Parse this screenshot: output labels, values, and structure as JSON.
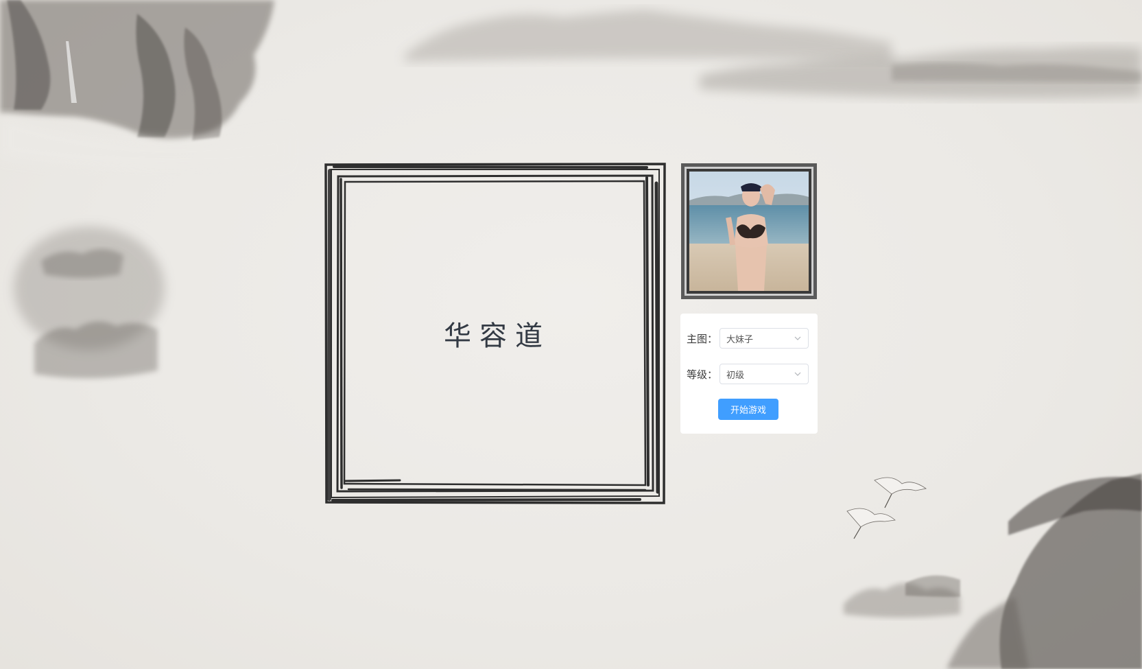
{
  "game": {
    "title": "华容道"
  },
  "controls": {
    "image_label": "主图：",
    "image_value": "大妹子",
    "level_label": "等级：",
    "level_value": "初级",
    "start_label": "开始游戏"
  },
  "colors": {
    "accent": "#409eff",
    "background": "#eceae6",
    "ink": "#333a44",
    "frame": "#2e2e2e"
  },
  "icons": {
    "select_arrow": "chevron-down-icon"
  }
}
